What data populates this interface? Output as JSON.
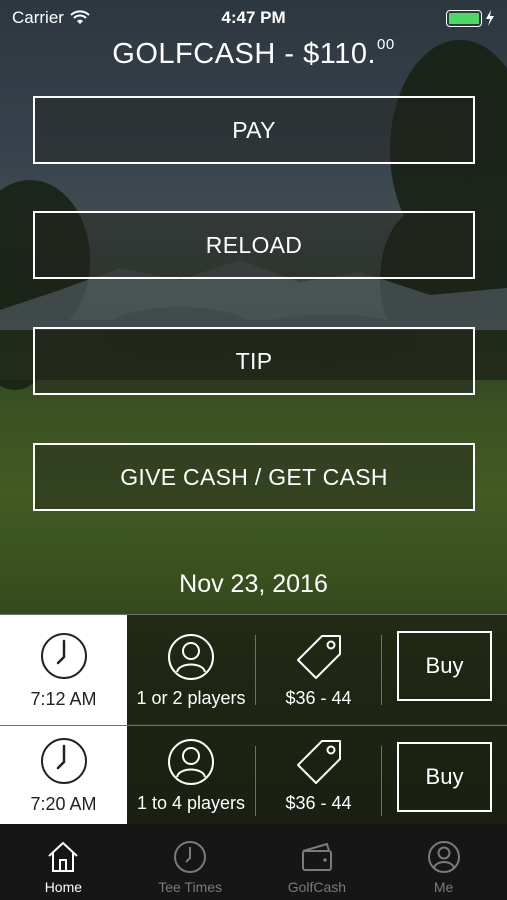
{
  "status_bar": {
    "carrier": "Carrier",
    "time": "4:47 PM"
  },
  "header": {
    "title": "GOLFCASH - $110.",
    "cents": "00"
  },
  "actions": [
    {
      "label": "PAY"
    },
    {
      "label": "RELOAD"
    },
    {
      "label": "TIP"
    },
    {
      "label": "GIVE CASH / GET CASH"
    }
  ],
  "date": "Nov 23, 2016",
  "tee_times": [
    {
      "time": "7:12 AM",
      "players": "1 or 2 players",
      "price": "$36 - 44",
      "buy_label": "Buy"
    },
    {
      "time": "7:20 AM",
      "players": "1 to 4 players",
      "price": "$36 - 44",
      "buy_label": "Buy"
    }
  ],
  "tabs": [
    {
      "label": "Home",
      "icon": "home-icon",
      "active": true
    },
    {
      "label": "Tee Times",
      "icon": "clock-icon",
      "active": false
    },
    {
      "label": "GolfCash",
      "icon": "wallet-icon",
      "active": false
    },
    {
      "label": "Me",
      "icon": "person-icon",
      "active": false
    }
  ],
  "colors": {
    "battery": "#4cd964",
    "tabbar": "#161616",
    "timebox": "#ffffff"
  }
}
